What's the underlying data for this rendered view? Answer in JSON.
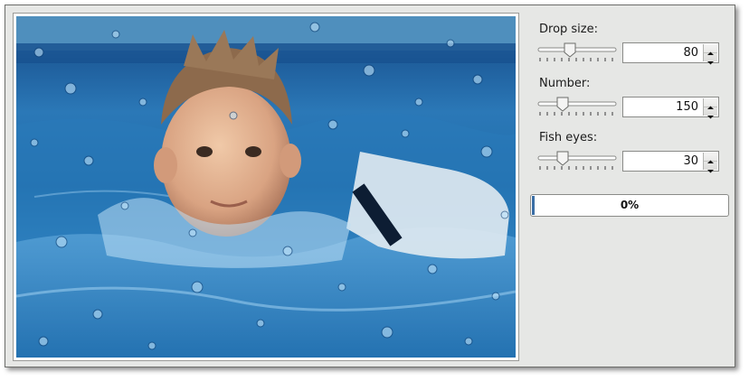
{
  "controls": {
    "drop_size": {
      "label": "Drop size:",
      "value": "80",
      "level": 0.4
    },
    "number": {
      "label": "Number:",
      "value": "150",
      "level": 0.3
    },
    "fish_eyes": {
      "label": "Fish eyes:",
      "value": "30",
      "level": 0.3
    }
  },
  "progress": {
    "text": "0%",
    "fraction": 0.0
  },
  "colors": {
    "window_bg": "#e6e7e5",
    "water": "#2b78b7",
    "progress_fill": "#3a6ea5"
  },
  "icons": [
    "slider-handle-icon",
    "spin-up-arrow-icon",
    "spin-down-arrow-icon"
  ]
}
